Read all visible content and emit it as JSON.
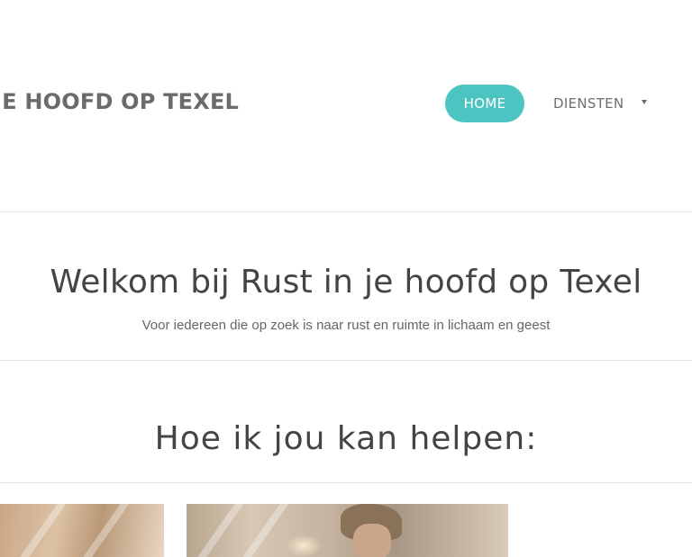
{
  "header": {
    "site_title": "T IN JE HOOFD OP TEXEL",
    "nav": {
      "home_label": "HOME",
      "diensten_label": "DIENSTEN"
    }
  },
  "hero": {
    "title": "Welkom bij Rust in je hoofd op Texel",
    "subtitle": "Voor iedereen die op zoek is naar rust en ruimte in lichaam en geest"
  },
  "services": {
    "title": "Hoe ik jou kan helpen:"
  },
  "colors": {
    "accent": "#4cc4c1",
    "text": "#444444",
    "muted": "#6b6b6b",
    "divider": "#e4e4e4"
  }
}
